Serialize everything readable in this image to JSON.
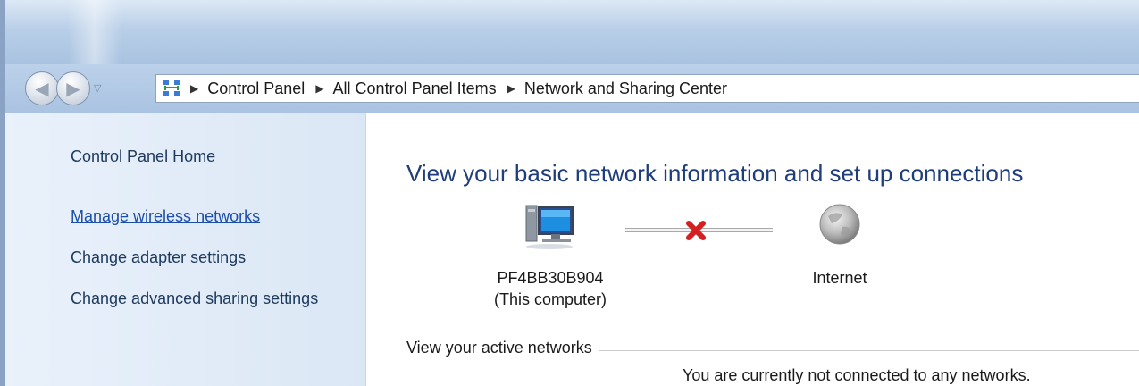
{
  "breadcrumb": {
    "items": [
      "Control Panel",
      "All Control Panel Items",
      "Network and Sharing Center"
    ],
    "icon": "network-icon"
  },
  "navigation": {
    "back_icon": "back-arrow-icon",
    "forward_icon": "forward-arrow-icon",
    "history_icon": "chevron-down-icon"
  },
  "sidebar": {
    "home": "Control Panel Home",
    "links": [
      "Manage wireless networks",
      "Change adapter settings",
      "Change advanced sharing settings"
    ]
  },
  "main": {
    "title": "View your basic network information and set up connections",
    "network_map": {
      "computer_name": "PF4BB30B904",
      "computer_sub": "(This computer)",
      "internet_label": "Internet",
      "status_icon": "red-x-icon"
    },
    "active_networks": {
      "label": "View your active networks",
      "status": "You are currently not connected to any networks."
    }
  },
  "colors": {
    "title": "#1e3d7a",
    "link": "#1c4fa8",
    "sidebar_bg": "#dbe7f5",
    "error": "#d42020"
  }
}
